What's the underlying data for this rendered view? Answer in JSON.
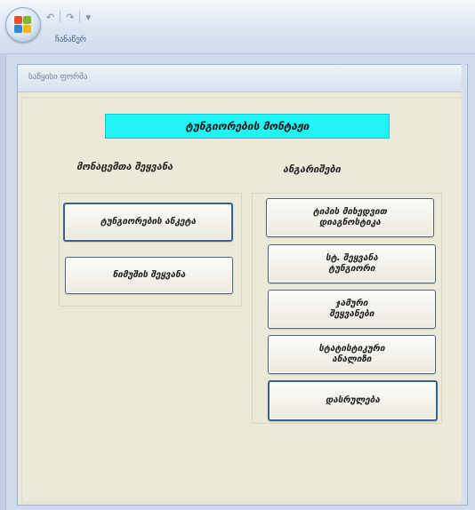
{
  "window": {
    "quick_access_undo": "↶",
    "quick_access_redo": "↷",
    "quick_access_more": "▾",
    "tab_label": "ჩანაწერ"
  },
  "form": {
    "title": "საწყისი ფორმა",
    "banner": "ტუნგიორების მონტაჟი",
    "left_heading": "მონაცემთა შეყვანა",
    "right_heading": "ანგარიშები",
    "left_buttons": [
      "ტუნგიორების ანკეტა",
      "ნიმუშის შეყვანა"
    ],
    "right_buttons": [
      "ტიპის მიხედვით\nდიაგნოსტიკა",
      "სტ. შეყვანა\nტუნგიორი",
      "ჯამური\nშეყვანები",
      "სტატისტიკური\nანალიზი",
      "დასრულება"
    ]
  },
  "colors": {
    "banner_bg": "#22f3f5",
    "form_bg": "#ece9d8",
    "ribbon_bg": "#dbe5f1"
  }
}
